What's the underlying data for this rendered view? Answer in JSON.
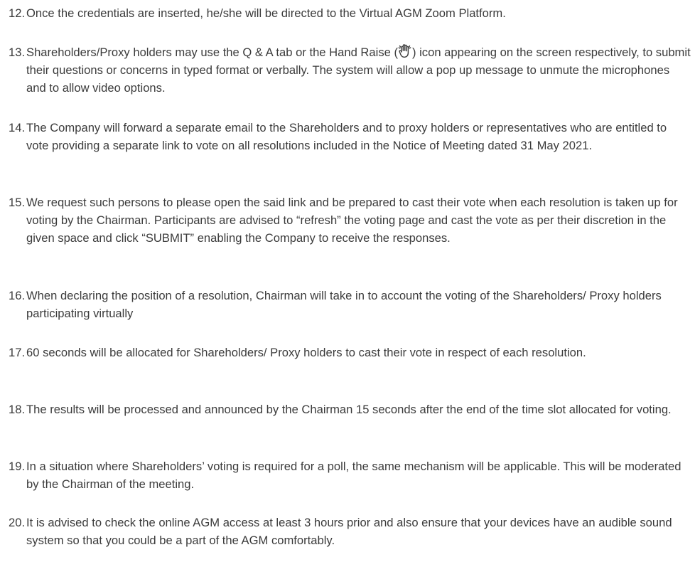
{
  "items": [
    {
      "number": "12.",
      "text": "Once the credentials are inserted, he/she will be directed to the Virtual AGM Zoom Platform."
    },
    {
      "number": "13.",
      "text_before_icon": "Shareholders/Proxy holders may use the Q & A tab or the Hand Raise (",
      "icon": "raised-hand-icon",
      "text_after_icon": ") icon appearing on the screen respectively, to submit their questions or concerns in typed format or verbally. The system will allow a pop up message to unmute the microphones and to allow video options."
    },
    {
      "number": "14.",
      "text": "The Company will forward a separate email to the Shareholders and to proxy holders or representatives who are entitled to vote providing a separate link to vote on all resolutions included in the Notice of Meeting dated 31 May 2021."
    },
    {
      "number": "15.",
      "text": "We request such persons to please open the said link and be prepared to cast their vote when each resolution is taken up for voting by the Chairman. Participants are advised to “refresh” the voting page and cast the vote as per their discretion in the given space and click “SUBMIT” enabling the Company to receive the responses."
    },
    {
      "number": "16.",
      "text": "When declaring the position of a resolution, Chairman will take in to account the voting of the Shareholders/ Proxy holders participating virtually"
    },
    {
      "number": "17.",
      "text": "60 seconds will be allocated for Shareholders/ Proxy holders to cast their vote in respect of each resolution."
    },
    {
      "number": "18.",
      "text": "The results will be processed and announced by the Chairman 15 seconds after the end of the time slot allocated for voting."
    },
    {
      "number": "19.",
      "text": "In a situation where Shareholders’ voting is required for a poll, the same mechanism will be applicable. This will be moderated by the Chairman of the meeting."
    },
    {
      "number": "20.",
      "text": "It is advised to check the online AGM access at least 3 hours prior and also ensure that your devices have an audible sound system so that you could be a part of the AGM comfortably."
    }
  ]
}
